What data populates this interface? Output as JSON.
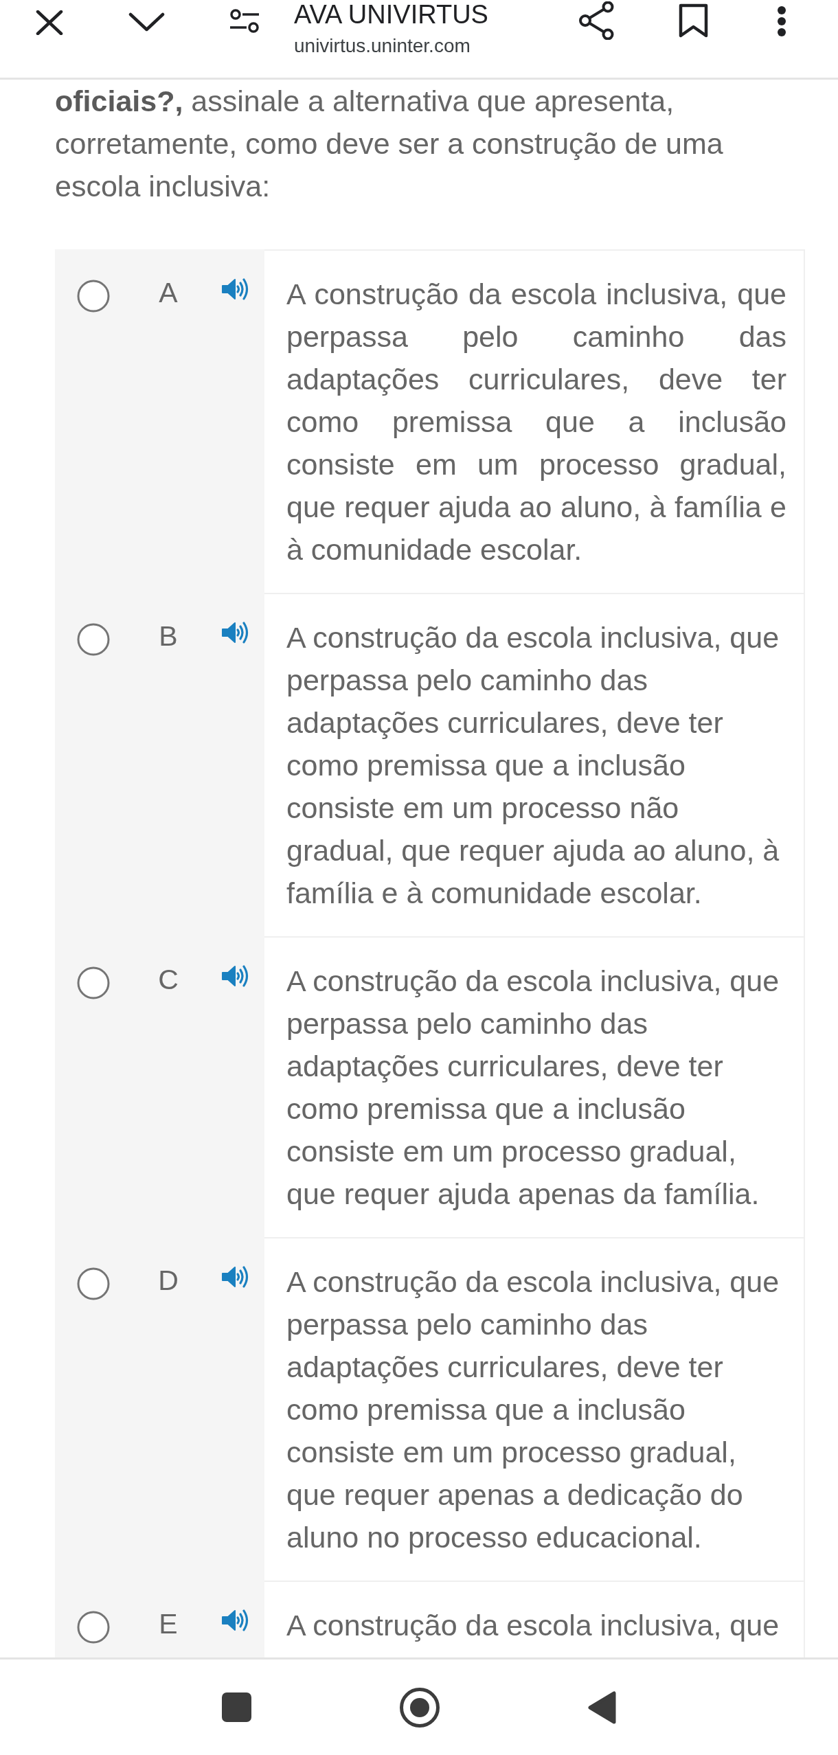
{
  "browser_bar": {
    "title": "AVA UNIVIRTUS",
    "url": "univirtus.uninter.com"
  },
  "question": {
    "text": "**oficiais?,** assinale a alternativa que apresenta, corretamente, como deve ser a construção de uma escola inclusiva:"
  },
  "options": [
    {
      "letter": "A",
      "selected": false,
      "text": "A construção da escola inclusiva, que perpassa pelo caminho das adaptações curriculares, deve ter como premissa que a inclusão consiste em um processo gradual, que requer ajuda ao aluno, à família e à comunidade escolar."
    },
    {
      "letter": "B",
      "selected": false,
      "text": "A construção da escola inclusiva, que perpassa pelo caminho das adaptações curriculares, deve ter como premissa que a inclusão consiste em um processo não gradual, que requer ajuda ao aluno, à família e à comunidade escolar."
    },
    {
      "letter": "C",
      "selected": false,
      "text": "A construção da escola inclusiva, que perpassa pelo caminho das adaptações curriculares, deve ter como premissa que a inclusão consiste em um processo gradual, que requer ajuda apenas da família."
    },
    {
      "letter": "D",
      "selected": false,
      "text": "A construção da escola inclusiva, que perpassa pelo caminho das adaptações curriculares, deve ter como premissa que a inclusão consiste em um processo gradual, que requer apenas a dedicação do aluno no processo educacional."
    },
    {
      "letter": "E",
      "selected": false,
      "text": "A construção da escola inclusiva, que"
    }
  ]
}
